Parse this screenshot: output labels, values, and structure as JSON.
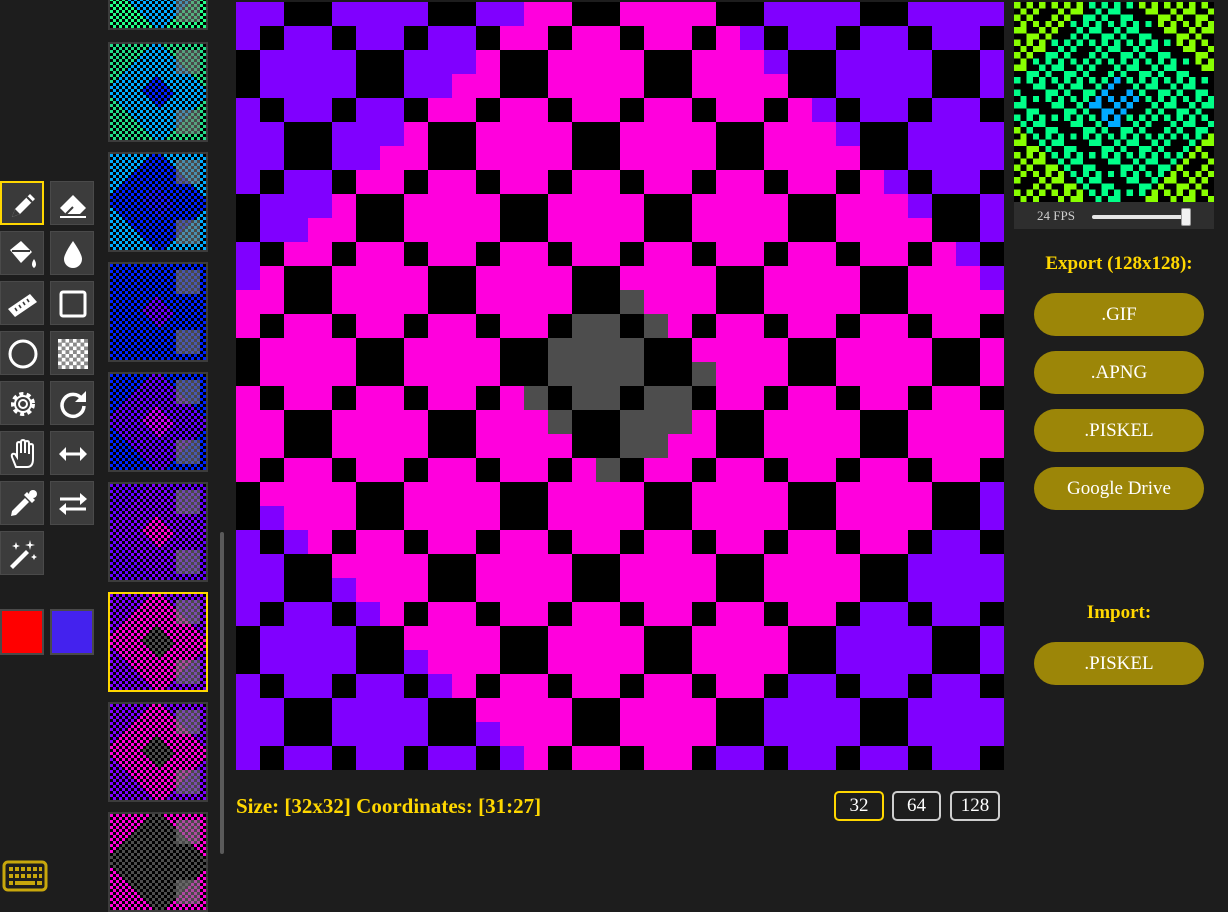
{
  "tools": [
    {
      "name": "pencil-icon",
      "active": true
    },
    {
      "name": "eraser-icon",
      "active": false
    },
    {
      "name": "paint-bucket-icon",
      "active": false
    },
    {
      "name": "droplet-icon",
      "active": false
    },
    {
      "name": "ruler-icon",
      "active": false
    },
    {
      "name": "square-icon",
      "active": false
    },
    {
      "name": "circle-icon",
      "active": false
    },
    {
      "name": "checkerboard-icon",
      "active": false
    },
    {
      "name": "gear-icon",
      "active": false
    },
    {
      "name": "redo-icon",
      "active": false
    },
    {
      "name": "hand-icon",
      "active": false
    },
    {
      "name": "horizontal-arrows-icon",
      "active": false
    },
    {
      "name": "eyedropper-icon",
      "active": false
    },
    {
      "name": "swap-arrows-icon",
      "active": false
    },
    {
      "name": "magic-wand-icon",
      "active": false
    }
  ],
  "colors": {
    "primary": "#ff0000",
    "secondary": "#4422ee",
    "accent": "#ffd700",
    "button": "#9c8608",
    "purple": "#8000ff",
    "magenta": "#ff00dd",
    "gray": "#4d4d4d",
    "black": "#000000"
  },
  "frames": {
    "active_index": 6,
    "palettes": [
      [
        "#22ff88",
        "#00aaff",
        "#000000",
        "#7a7a7a"
      ],
      [
        "#22dd88",
        "#00aaff",
        "#0022ff",
        "#7a7a7a"
      ],
      [
        "#00aaff",
        "#0022ff",
        "#1a1aff",
        "#7a7a7a"
      ],
      [
        "#0022ff",
        "#0022ff",
        "#6600ff",
        "#7a7a7a"
      ],
      [
        "#0022ff",
        "#6600ff",
        "#cc00ff",
        "#7a7a7a"
      ],
      [
        "#6600ff",
        "#8000ff",
        "#ff00dd",
        "#7a7a7a"
      ],
      [
        "#8000ff",
        "#ff00dd",
        "#4d4d4d",
        "#7a7a7a"
      ],
      [
        "#8000ff",
        "#ff00dd",
        "#4d4d4d",
        "#7a7a7a"
      ],
      [
        "#ff00dd",
        "#4d4d4d",
        "#4d4d4d",
        "#7a7a7a"
      ]
    ]
  },
  "status": {
    "size_label": "Size:",
    "size_value": "[32x32]",
    "coordinates_label": "Coordinates:",
    "coordinates_value": "[31:27]"
  },
  "canvas_sizes": [
    {
      "label": "32",
      "active": true
    },
    {
      "label": "64",
      "active": false
    },
    {
      "label": "128",
      "active": false
    }
  ],
  "preview": {
    "fps_label": "24 FPS",
    "fps_value": 24
  },
  "export": {
    "title": "Export (128x128):",
    "gif": ".GIF",
    "apng": ".APNG",
    "piskel": ".PISKEL",
    "google_drive": "Google Drive"
  },
  "import": {
    "title": "Import:",
    "piskel": ".PISKEL"
  },
  "keyboard_icon": "keyboard-icon"
}
